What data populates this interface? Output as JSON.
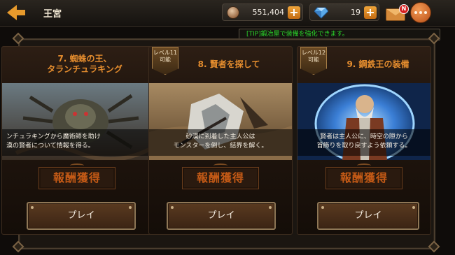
{
  "header": {
    "title": "王宮",
    "coins": "551,404",
    "gems": "19",
    "mail_badge": "N"
  },
  "tip": "[TIP]鍛冶屋で装備を強化できます。",
  "cards": [
    {
      "title_line1": "7. 蜘蛛の王、",
      "title_line2": "タランチュラキング",
      "level_line1": "",
      "level_line2": "",
      "desc_line1": "ンチュラキングから魔術師を助け",
      "desc_line2": "漠の賢者について情報を得る。",
      "reward": "報酬獲得",
      "play": "プレイ"
    },
    {
      "title_line1": "8. 賢者を探して",
      "title_line2": "",
      "level_line1": "レベル11",
      "level_line2": "可能",
      "desc_line1": "砂漠に到着した主人公は",
      "desc_line2": "モンスターを倒し、結界を解く。",
      "reward": "報酬獲得",
      "play": "プレイ"
    },
    {
      "title_line1": "9. 鋼鉄王の装備",
      "title_line2": "",
      "level_line1": "レベル12",
      "level_line2": "可能",
      "desc_line1": "賢者は主人公に、時空の隙から",
      "desc_line2": "首飾りを取り戻すよう依頼する。",
      "reward": "報酬獲得",
      "play": "プレイ"
    }
  ],
  "colors": {
    "accent_orange": "#e58d2e",
    "tip_green": "#2bd82b",
    "badge_red": "#d42121"
  },
  "icons": [
    "back-arrow-icon",
    "coin-icon",
    "gem-icon",
    "plus-icon",
    "mail-icon",
    "chat-icon"
  ]
}
